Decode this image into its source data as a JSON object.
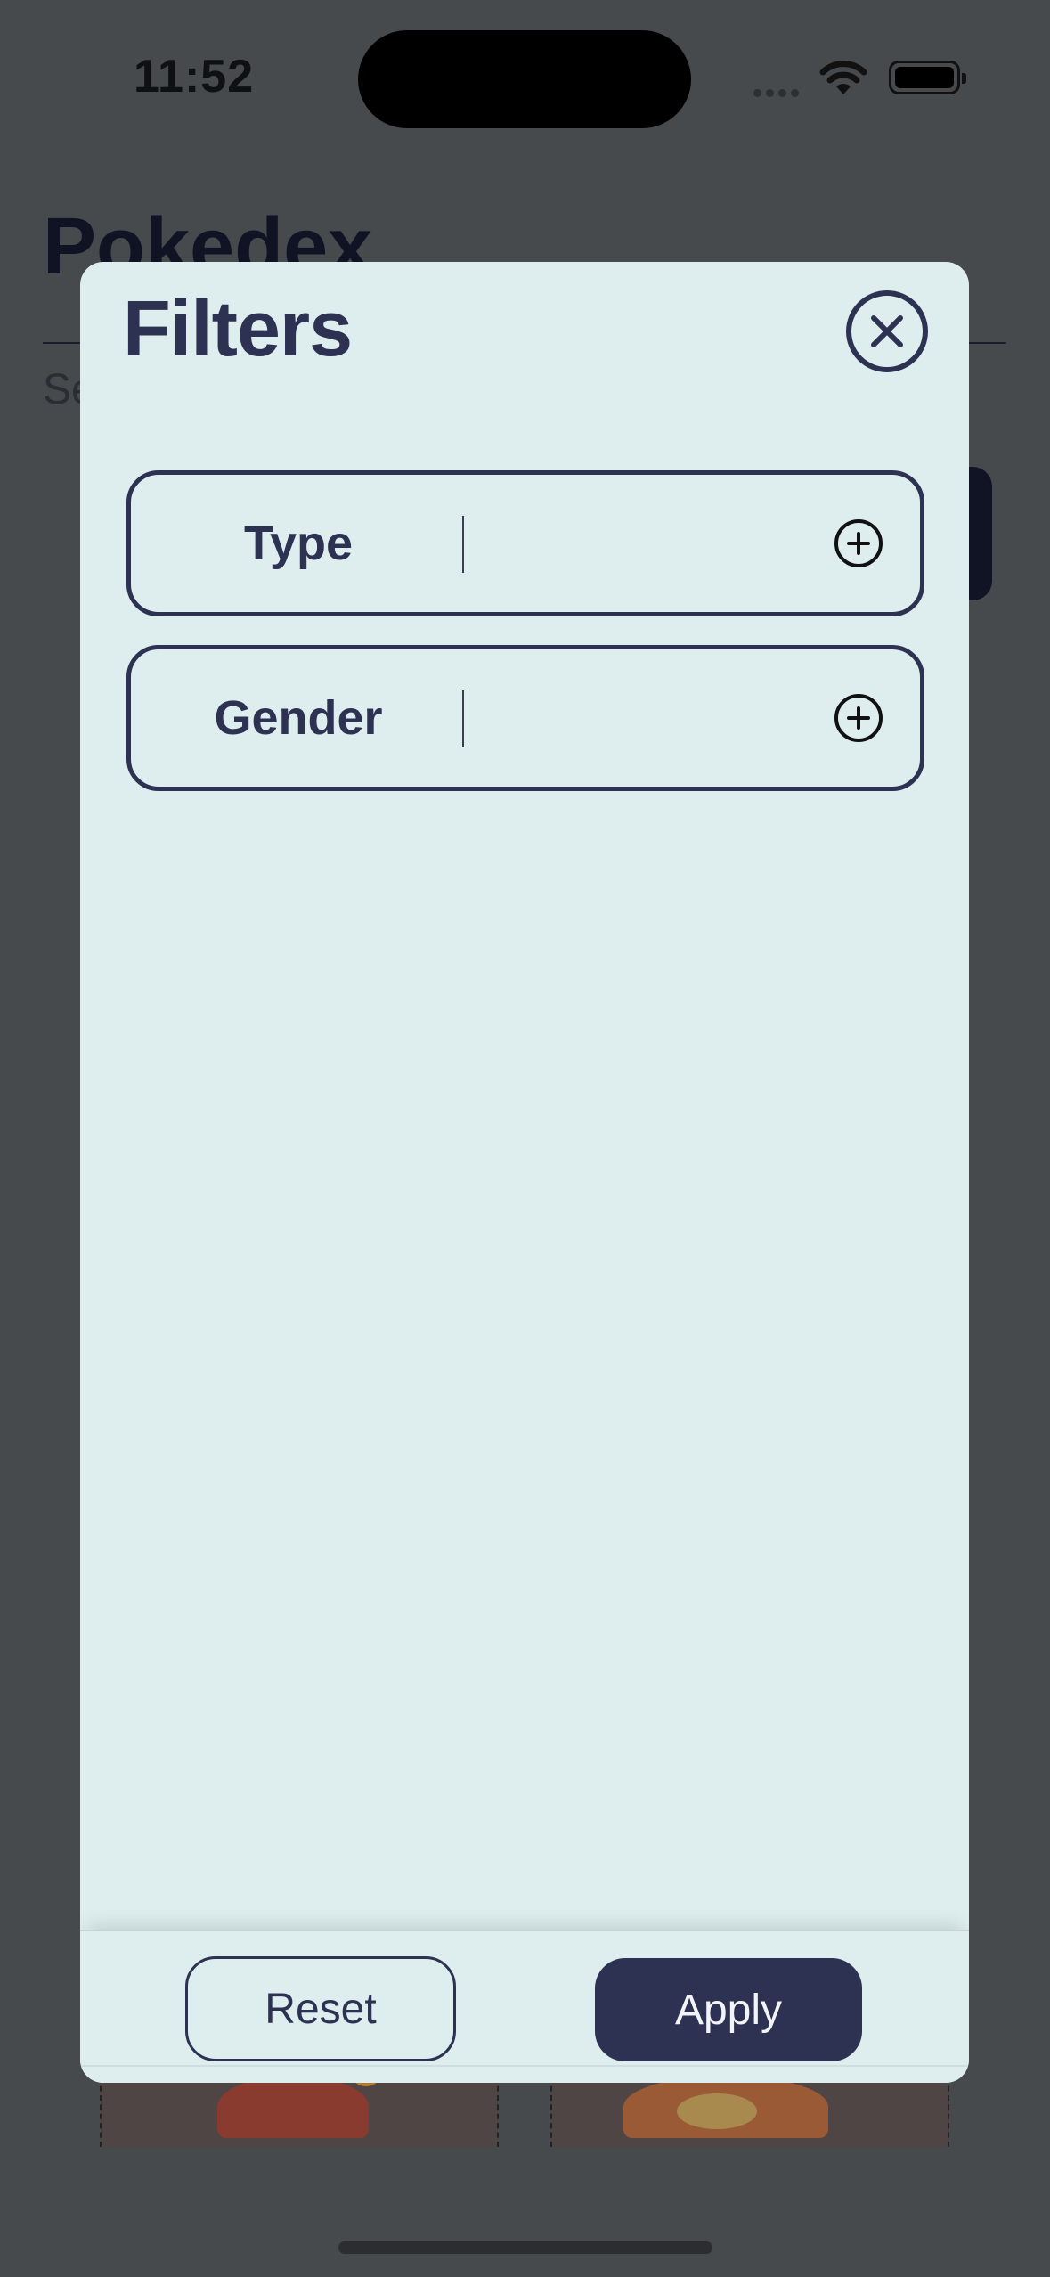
{
  "status_bar": {
    "time": "11:52",
    "wifi_icon": "wifi-icon",
    "battery_icon": "battery-icon"
  },
  "background_page": {
    "title": "Pokedex",
    "subtitle_partial": "Se"
  },
  "filters_modal": {
    "title": "Filters",
    "close_icon": "close-circle-icon",
    "rows": [
      {
        "label": "Type",
        "add_icon": "add-circle-icon"
      },
      {
        "label": "Gender",
        "add_icon": "add-circle-icon"
      }
    ],
    "footer": {
      "reset_label": "Reset",
      "apply_label": "Apply"
    }
  },
  "colors": {
    "modal_background": "#deeeee",
    "accent_navy": "#2d3152",
    "dim_overlay": "#464a4d"
  }
}
